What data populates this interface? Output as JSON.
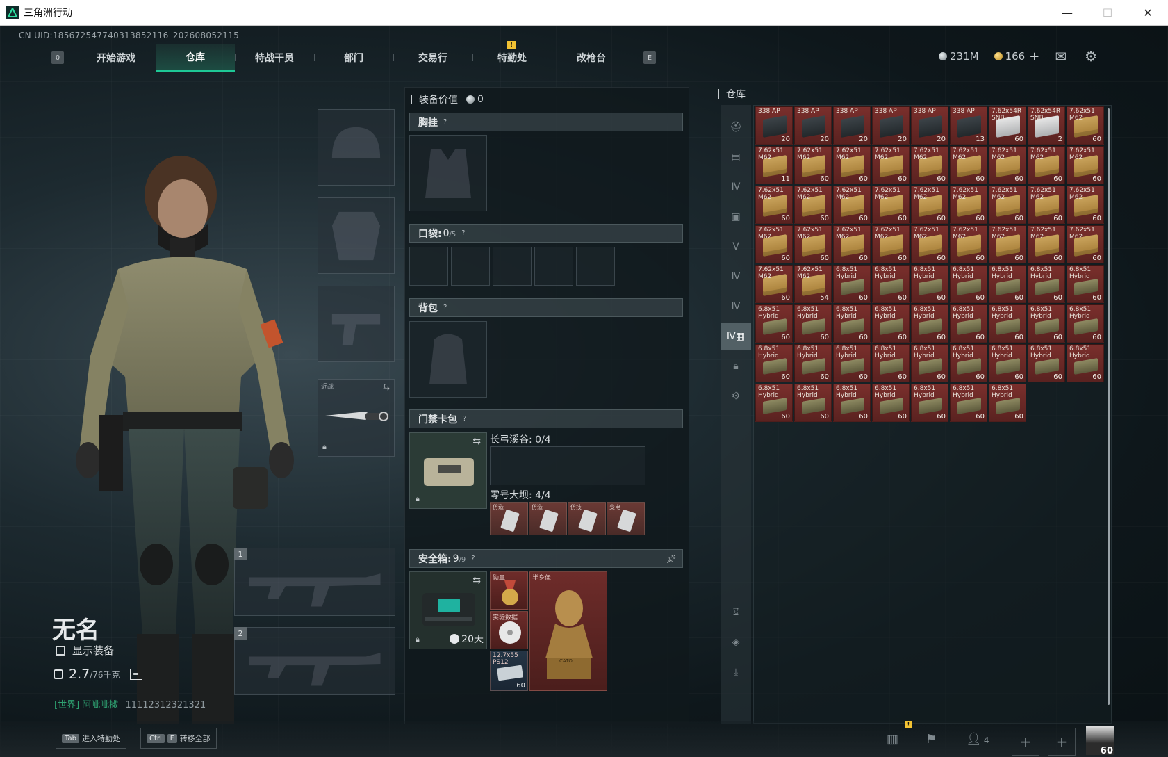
{
  "window": {
    "title": "三角洲行动",
    "minimize": "—",
    "maximize": "☐",
    "close": "✕"
  },
  "uid_text": "CN UID:185672547740313852116_202608052115",
  "topnav": {
    "left_key": "Q",
    "right_key": "E",
    "tabs": [
      {
        "label": "开始游戏"
      },
      {
        "label": "仓库",
        "active": true
      },
      {
        "label": "特战干员"
      },
      {
        "label": "部门"
      },
      {
        "label": "交易行"
      },
      {
        "label": "特勤处",
        "alert": "!"
      },
      {
        "label": "改枪台"
      }
    ]
  },
  "currency": {
    "silver": "231M",
    "gold": "166",
    "plus": "+",
    "mail_icon": "mail-icon",
    "settings_icon": "gear-icon"
  },
  "character": {
    "name": "无名",
    "show_equipment_label": "显示装备",
    "weight_value": "2.7",
    "weight_max": "/76千克",
    "chat_channel": "[世界]",
    "chat_user": "阿呲呲撒",
    "chat_msg": "11112312321321"
  },
  "equip_slots": {
    "melee_label": "近战",
    "primary_num": "1",
    "secondary_num": "2"
  },
  "mid_panel": {
    "equip_value_label": "装备价值",
    "equip_value": "0",
    "chest_rig": "胸挂",
    "pocket": "口袋:",
    "pocket_count": "0",
    "pocket_max": "/5",
    "backpack": "背包",
    "keycard_case": "门禁卡包",
    "keycard_map1": "长弓溪谷: 0/4",
    "keycard_map2": "零号大坝: 4/4",
    "keycards": [
      {
        "label": "仿造"
      },
      {
        "label": "仿造"
      },
      {
        "label": "仿技"
      },
      {
        "label": "变电"
      }
    ],
    "safebox": "安全箱:",
    "safebox_count": "9",
    "safebox_max": "/9",
    "safebox_days": "20天",
    "safe_items": {
      "medal_label": "勋章",
      "disc_label": "实验数据",
      "ammo_label": "12.7x55 PS12",
      "ammo_qty": "60",
      "bust_label": "半身像",
      "bust_engraving": "CATO"
    },
    "question_mark": "?"
  },
  "warehouse": {
    "title": "仓库",
    "items": [
      {
        "name": "338 AP",
        "qty": "20",
        "color": "red",
        "box": "case"
      },
      {
        "name": "338 AP",
        "qty": "20",
        "color": "red",
        "box": "case"
      },
      {
        "name": "338 AP",
        "qty": "20",
        "color": "red",
        "box": "case"
      },
      {
        "name": "338 AP",
        "qty": "20",
        "color": "red",
        "box": "case"
      },
      {
        "name": "338 AP",
        "qty": "20",
        "color": "red",
        "box": "case"
      },
      {
        "name": "338 AP",
        "qty": "13",
        "color": "red",
        "box": "case"
      },
      {
        "name": "7.62x54R SNB",
        "qty": "60",
        "color": "red",
        "box": "white"
      },
      {
        "name": "7.62x54R SNB",
        "qty": "2",
        "color": "red",
        "box": "white"
      },
      {
        "name": "7.62x51 M62",
        "qty": "60",
        "color": "red",
        "box": "crate"
      },
      {
        "name": "7.62x51 M62",
        "qty": "11",
        "color": "red",
        "box": "crate"
      },
      {
        "name": "7.62x51 M62",
        "qty": "60",
        "color": "red",
        "box": "crate"
      },
      {
        "name": "7.62x51 M62",
        "qty": "60",
        "color": "red",
        "box": "crate"
      },
      {
        "name": "7.62x51 M62",
        "qty": "60",
        "color": "red",
        "box": "crate"
      },
      {
        "name": "7.62x51 M62",
        "qty": "60",
        "color": "red",
        "box": "crate"
      },
      {
        "name": "7.62x51 M62",
        "qty": "60",
        "color": "red",
        "box": "crate"
      },
      {
        "name": "7.62x51 M62",
        "qty": "60",
        "color": "red",
        "box": "crate"
      },
      {
        "name": "7.62x51 M62",
        "qty": "60",
        "color": "red",
        "box": "crate"
      },
      {
        "name": "7.62x51 M62",
        "qty": "60",
        "color": "red",
        "box": "crate"
      },
      {
        "name": "7.62x51 M62",
        "qty": "60",
        "color": "red",
        "box": "crate"
      },
      {
        "name": "7.62x51 M62",
        "qty": "60",
        "color": "red",
        "box": "crate"
      },
      {
        "name": "7.62x51 M62",
        "qty": "60",
        "color": "red",
        "box": "crate"
      },
      {
        "name": "7.62x51 M62",
        "qty": "60",
        "color": "red",
        "box": "crate"
      },
      {
        "name": "7.62x51 M62",
        "qty": "60",
        "color": "red",
        "box": "crate"
      },
      {
        "name": "7.62x51 M62",
        "qty": "60",
        "color": "red",
        "box": "crate"
      },
      {
        "name": "7.62x51 M62",
        "qty": "60",
        "color": "red",
        "box": "crate"
      },
      {
        "name": "7.62x51 M62",
        "qty": "60",
        "color": "red",
        "box": "crate"
      },
      {
        "name": "7.62x51 M62",
        "qty": "60",
        "color": "red",
        "box": "crate"
      },
      {
        "name": "7.62x51 M62",
        "qty": "60",
        "color": "red",
        "box": "crate"
      },
      {
        "name": "7.62x51 M62",
        "qty": "60",
        "color": "red",
        "box": "crate"
      },
      {
        "name": "7.62x51 M62",
        "qty": "60",
        "color": "red",
        "box": "crate"
      },
      {
        "name": "7.62x51 M62",
        "qty": "60",
        "color": "red",
        "box": "crate"
      },
      {
        "name": "7.62x51 M62",
        "qty": "60",
        "color": "red",
        "box": "crate"
      },
      {
        "name": "7.62x51 M62",
        "qty": "60",
        "color": "red",
        "box": "crate"
      },
      {
        "name": "7.62x51 M62",
        "qty": "60",
        "color": "red",
        "box": "crate"
      },
      {
        "name": "7.62x51 M62",
        "qty": "60",
        "color": "red",
        "box": "crate"
      },
      {
        "name": "7.62x51 M62",
        "qty": "60",
        "color": "red",
        "box": "crate"
      },
      {
        "name": "7.62x51 M62",
        "qty": "60",
        "color": "red",
        "box": "crate"
      },
      {
        "name": "7.62x51 M62",
        "qty": "54",
        "color": "red",
        "box": "crate"
      },
      {
        "name": "6.8x51 Hybrid",
        "qty": "60",
        "color": "red",
        "box": "olive"
      },
      {
        "name": "6.8x51 Hybrid",
        "qty": "60",
        "color": "red",
        "box": "olive"
      },
      {
        "name": "6.8x51 Hybrid",
        "qty": "60",
        "color": "red",
        "box": "olive"
      },
      {
        "name": "6.8x51 Hybrid",
        "qty": "60",
        "color": "red",
        "box": "olive"
      },
      {
        "name": "6.8x51 Hybrid",
        "qty": "60",
        "color": "red",
        "box": "olive"
      },
      {
        "name": "6.8x51 Hybrid",
        "qty": "60",
        "color": "red",
        "box": "olive"
      },
      {
        "name": "6.8x51 Hybrid",
        "qty": "60",
        "color": "red",
        "box": "olive"
      },
      {
        "name": "6.8x51 Hybrid",
        "qty": "60",
        "color": "red",
        "box": "olive"
      },
      {
        "name": "6.8x51 Hybrid",
        "qty": "60",
        "color": "red",
        "box": "olive"
      },
      {
        "name": "6.8x51 Hybrid",
        "qty": "60",
        "color": "red",
        "box": "olive"
      },
      {
        "name": "6.8x51 Hybrid",
        "qty": "60",
        "color": "red",
        "box": "olive"
      },
      {
        "name": "6.8x51 Hybrid",
        "qty": "60",
        "color": "red",
        "box": "olive"
      },
      {
        "name": "6.8x51 Hybrid",
        "qty": "60",
        "color": "red",
        "box": "olive"
      },
      {
        "name": "6.8x51 Hybrid",
        "qty": "60",
        "color": "red",
        "box": "olive"
      },
      {
        "name": "6.8x51 Hybrid",
        "qty": "60",
        "color": "red",
        "box": "olive"
      },
      {
        "name": "6.8x51 Hybrid",
        "qty": "60",
        "color": "red",
        "box": "olive"
      },
      {
        "name": "6.8x51 Hybrid",
        "qty": "60",
        "color": "red",
        "box": "olive"
      },
      {
        "name": "6.8x51 Hybrid",
        "qty": "60",
        "color": "red",
        "box": "olive"
      },
      {
        "name": "6.8x51 Hybrid",
        "qty": "60",
        "color": "red",
        "box": "olive"
      },
      {
        "name": "6.8x51 Hybrid",
        "qty": "60",
        "color": "red",
        "box": "olive"
      },
      {
        "name": "6.8x51 Hybrid",
        "qty": "60",
        "color": "red",
        "box": "olive"
      },
      {
        "name": "6.8x51 Hybrid",
        "qty": "60",
        "color": "red",
        "box": "olive"
      },
      {
        "name": "6.8x51 Hybrid",
        "qty": "60",
        "color": "red",
        "box": "olive"
      },
      {
        "name": "6.8x51 Hybrid",
        "qty": "60",
        "color": "red",
        "box": "olive"
      },
      {
        "name": "6.8x51 Hybrid",
        "qty": "60",
        "color": "red",
        "box": "olive"
      },
      {
        "name": "6.8x51 Hybrid",
        "qty": "60",
        "color": "red",
        "box": "olive"
      },
      {
        "name": "6.8x51 Hybrid",
        "qty": "60",
        "color": "red",
        "box": "olive"
      },
      {
        "name": "6.8x51 Hybrid",
        "qty": "60",
        "color": "red",
        "box": "olive"
      },
      {
        "name": "6.8x51 Hybrid",
        "qty": "60",
        "color": "red",
        "box": "olive"
      },
      {
        "name": "6.8x51 Hybrid",
        "qty": "60",
        "color": "red",
        "box": "olive"
      },
      {
        "name": "6.8x51 Hybrid",
        "qty": "60",
        "color": "red",
        "box": "olive"
      },
      {
        "name": "6.8x51 Hybrid",
        "qty": "60",
        "color": "red",
        "box": "olive"
      }
    ],
    "sidebar_icons": [
      "helmet-icon",
      "armor-icon",
      "level4-icon",
      "case-icon",
      "level5-icon",
      "level4b-icon",
      "level4c-icon",
      "ammo-icon",
      "lock-icon",
      "settings-icon",
      "sort-icon",
      "layers-icon",
      "transfer-icon"
    ]
  },
  "bottombar": {
    "hint1_key": "Tab",
    "hint1_label": "进入特勤处",
    "hint2_key1": "Ctrl",
    "hint2_key2": "F",
    "hint2_label": "转移全部",
    "squad_count": "4",
    "alert": "!",
    "plus": "+",
    "avatar_level": "60"
  }
}
